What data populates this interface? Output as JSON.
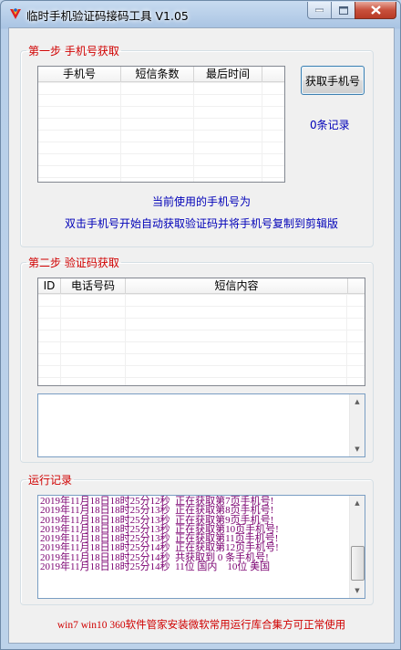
{
  "window": {
    "title": "临时手机验证码接码工具 V1.05"
  },
  "step1": {
    "legend": "第一步 手机号获取",
    "columns": [
      "手机号",
      "短信条数",
      "最后时间"
    ],
    "get_button": "获取手机号",
    "record_count": "0条记录",
    "current_phone_label": "当前使用的手机号为",
    "hint": "双击手机号开始自动获取验证码并将手机号复制到剪辑版"
  },
  "step2": {
    "legend": "第二步 验证码获取",
    "columns": [
      "ID",
      "电话号码",
      "短信内容"
    ]
  },
  "log": {
    "legend": "运行记录",
    "lines": [
      "2019年11月18日18时25分12秒  正在获取第7页手机号!",
      "2019年11月18日18时25分13秒  正在获取第8页手机号!",
      "2019年11月18日18时25分13秒  正在获取第9页手机号!",
      "2019年11月18日18时25分13秒  正在获取第10页手机号!",
      "2019年11月18日18时25分13秒  正在获取第11页手机号!",
      "2019年11月18日18时25分14秒  正在获取第12页手机号!",
      "2019年11月18日18时25分14秒  共获取到 0 条手机号!",
      "2019年11月18日18时25分14秒  11位 国内    10位 美国"
    ]
  },
  "footer": {
    "text": "win7 win10 360软件管家安装微软常用运行库合集方可正常使用"
  },
  "colors": {
    "legend": "#d00000",
    "info": "#0000b8",
    "log_text": "#7a0070"
  }
}
